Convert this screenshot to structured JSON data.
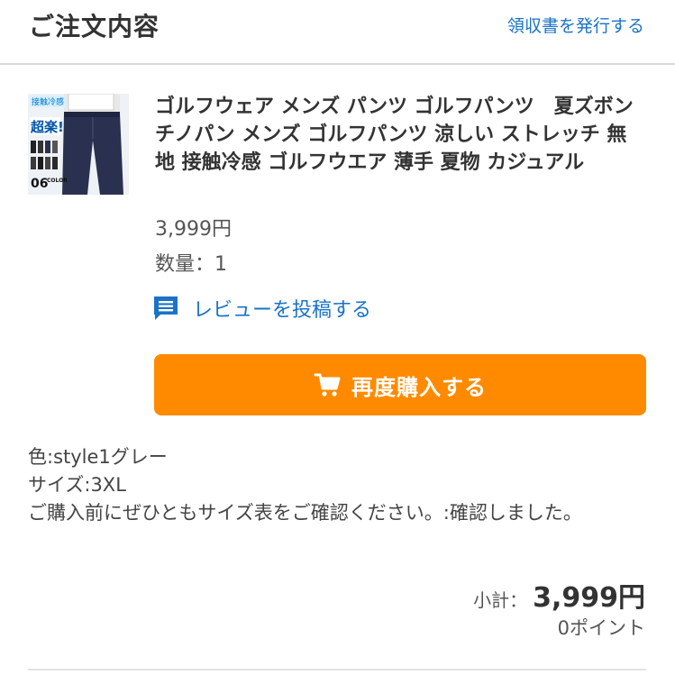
{
  "header": {
    "title": "ご注文内容",
    "receipt_link": "領収書を発行する"
  },
  "product": {
    "image_icon": "golf-pants-product-image",
    "image_text_top": "接触冷感",
    "image_text_badge": "超楽!",
    "image_text_colors": "06",
    "image_text_color_word": "COLOR",
    "title": "ゴルフウェア メンズ パンツ ゴルフパンツ　夏ズボン チノパン メンズ ゴルフパンツ 涼しい ストレッチ 無地 接触冷感 ゴルフウエア 薄手 夏物 カジュアル",
    "price": "3,999円",
    "quantity": "数量：1"
  },
  "actions": {
    "review_label": "レビューを投稿する",
    "review_icon": "comment-icon",
    "rebuy_label": "再度購入する",
    "rebuy_icon": "cart-icon",
    "accent_color": "#ff8a00",
    "link_color": "#1a73c8"
  },
  "options": {
    "color": "色:style1グレー",
    "size": "サイズ:3XL",
    "note": "ご購入前にぜひともサイズ表をご確認ください。:確認しました。"
  },
  "summary": {
    "subtotal_label": "小計：",
    "subtotal_value": "3,999円",
    "points": "0ポイント"
  }
}
